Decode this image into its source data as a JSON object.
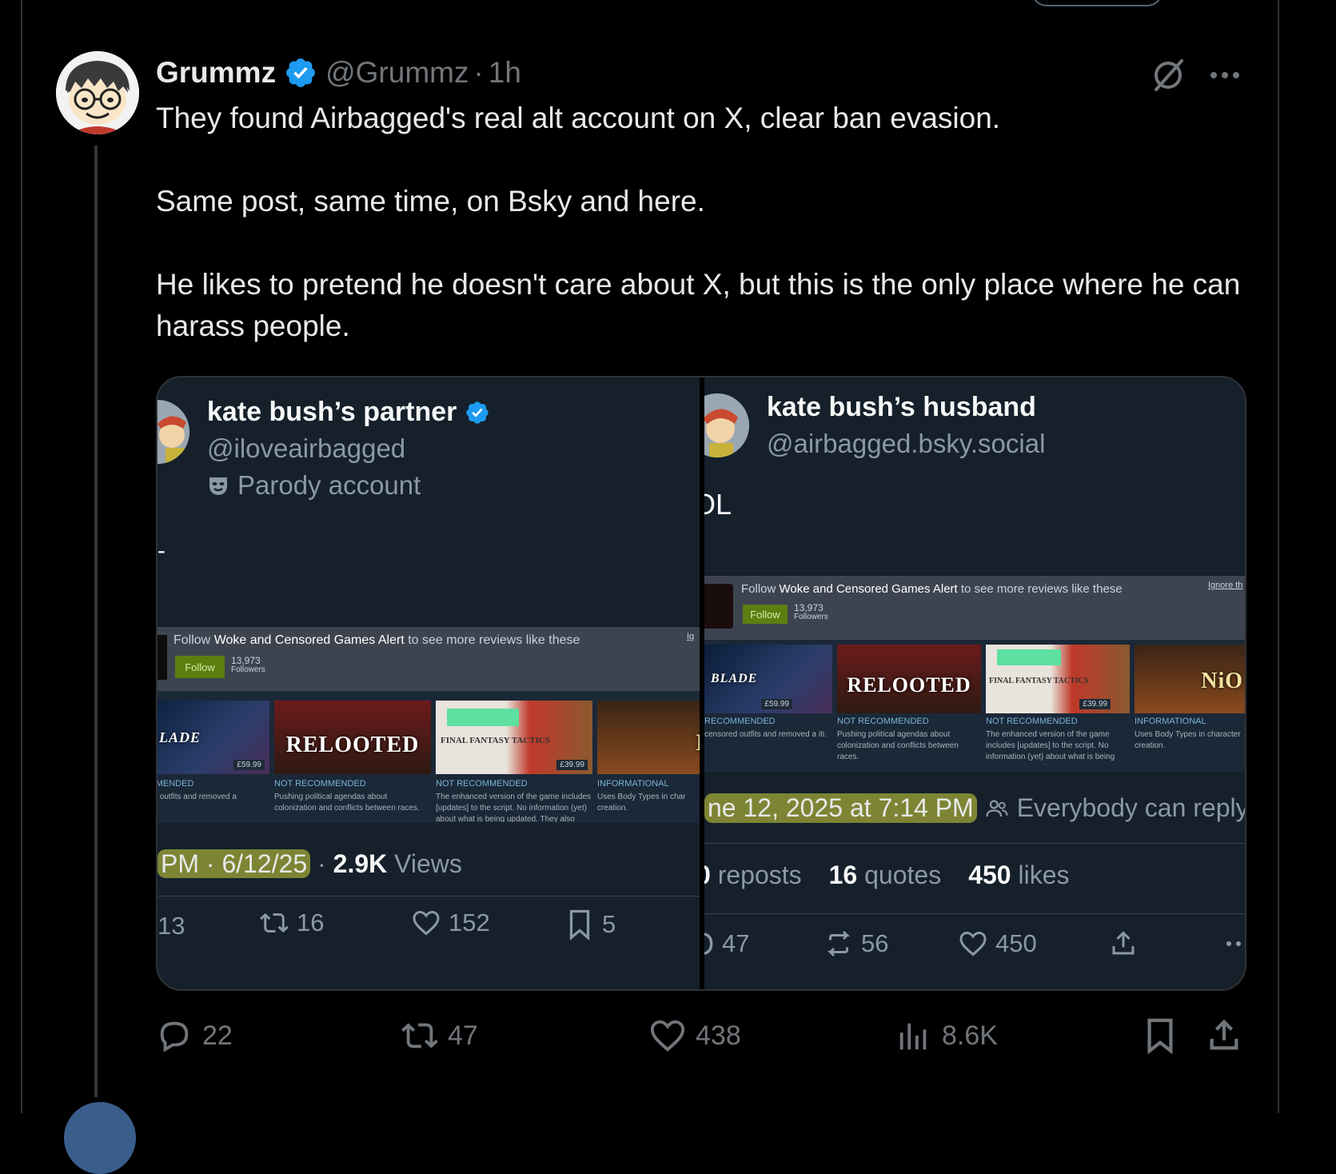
{
  "post": {
    "author_name": "Grummz",
    "author_handle": "@Grummz",
    "separator": "·",
    "time": "1h",
    "paragraphs": [
      "They found Airbagged's  real alt account on X, clear ban evasion.",
      "Same post, same time, on Bsky and here.",
      "He likes to pretend he doesn't care about X, but this is the only place where he can harass people."
    ],
    "actions": {
      "replies": "22",
      "reposts": "47",
      "likes": "438",
      "views": "8.6K"
    }
  },
  "screenshot_left": {
    "name": "kate bush’s partner",
    "handle": "@iloveairbagged",
    "badge": "Parody account",
    "dash": "-",
    "steam": {
      "follow_prefix": "Follow",
      "curator": "Woke and Censored Games Alert",
      "follow_suffix": "to see more reviews like these",
      "follow_button": "Follow",
      "followers_count": "13,973",
      "followers_label": "Followers",
      "ignore": "Ig"
    },
    "tiles": [
      {
        "title": "LADE",
        "price": "£59.99",
        "tag": "OMMENDED",
        "desc": "ored outfits and removed a"
      },
      {
        "title": "RELOOTED",
        "price": "",
        "tag": "NOT RECOMMENDED",
        "desc": "Pushing political agendas about colonization and conflicts between races."
      },
      {
        "title": "FINAL FANTASY TACTICS",
        "price": "£39.99",
        "tag": "NOT RECOMMENDED",
        "desc": "The enhanced version of the game includes [updates] to the script. No information (yet) about what is being updated. They also removed extra"
      },
      {
        "title": "N",
        "price": "",
        "tag": "INFORMATIONAL",
        "desc": "Uses Body Types in char creation."
      }
    ],
    "timestamp": "PM · 6/12/25",
    "views_sep": "·",
    "views_count": "2.9K",
    "views_label": "Views",
    "actions": {
      "replies": "13",
      "reposts": "16",
      "likes": "152",
      "bookmarks": "5"
    }
  },
  "screenshot_right": {
    "name": "kate bush’s husband",
    "handle": "@airbagged.bsky.social",
    "text": "OL",
    "steam": {
      "follow_prefix": "Follow",
      "curator": "Woke and Censored Games Alert",
      "follow_suffix": "to see more reviews like these",
      "follow_button": "Follow",
      "followers_count": "13,973",
      "followers_label": "Followers",
      "ignore": "Ignore th"
    },
    "tiles": [
      {
        "title": "BLADE",
        "price": "£59.99",
        "tag": "RECOMMENDED",
        "desc": "censored outfits and removed a iti."
      },
      {
        "title": "RELOOTED",
        "price": "",
        "tag": "NOT RECOMMENDED",
        "desc": "Pushing political agendas about colonization and conflicts between races."
      },
      {
        "title": "FINAL FANTASY TACTICS",
        "price": "£39.99",
        "tag": "NOT RECOMMENDED",
        "desc": "The enhanced version of the game includes [updates] to the script. No information (yet) about what is being updated. They also removed extra"
      },
      {
        "title": "NiO",
        "price": "",
        "tag": "INFORMATIONAL",
        "desc": "Uses Body Types in character creation."
      }
    ],
    "timestamp": "ne 12, 2025 at 7:14 PM",
    "reply_setting": "Everybody can reply",
    "stats": {
      "reposts_count": "0",
      "reposts_label": "reposts",
      "quotes_count": "16",
      "quotes_label": "quotes",
      "likes_count": "450",
      "likes_label": "likes"
    },
    "actions": {
      "replies": "47",
      "reposts": "56",
      "likes": "450"
    }
  },
  "colors": {
    "background": "#000000",
    "verified_blue": "#1d9bf0",
    "highlight": "#d4d83c",
    "steam_follow_green": "#5c7e10"
  }
}
